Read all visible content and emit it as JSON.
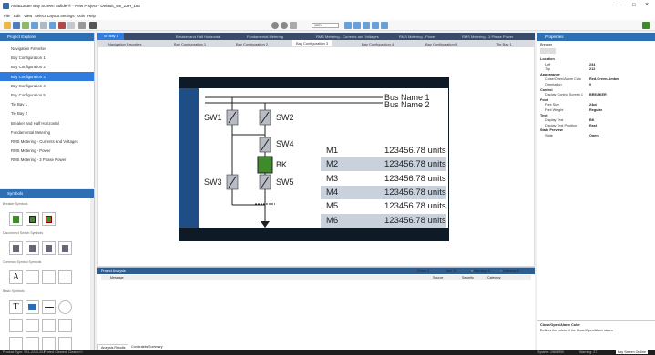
{
  "titlebar": {
    "title": "ActiBLaster Bay Screen Builder® - New Project - Default_ste_22H_183",
    "min": "–",
    "max": "□",
    "close": "×"
  },
  "menu": [
    "File",
    "Edit",
    "View",
    "Select",
    "Layout",
    "Settings",
    "Tools",
    "Help"
  ],
  "toolbar": {
    "zoom": "100%"
  },
  "project_explorer": {
    "title": "Project Explorer",
    "items": [
      "Navigation Favorites",
      "Bay Configuration 1",
      "Bay Configuration 2",
      "Bay Configuration 3",
      "Bay Configuration 4",
      "Bay Configuration 5",
      "Tie Bay 1",
      "Tie Bay 2",
      "Breaker and Half Horizontal",
      "Fundamental Metering",
      "RMS Metering - Currents and Voltages",
      "RMS Metering - Power",
      "RMS Metering - 3 Phase Power"
    ],
    "selected_index": 3
  },
  "symbols": {
    "title": "Symbols",
    "groups": [
      "Breaker Symbols",
      "Disconnect Switch Symbols",
      "Common Symbol Symbols",
      "Basic Symbols"
    ]
  },
  "doc_tabs": [
    "Tie Bay 1",
    "Breaker and Half Horizontal",
    "Fundamental Metering",
    "RMS Metering - Currents and Voltages",
    "RMS Metering - Power",
    "RMS Metering - 3 Phase Power"
  ],
  "doc_subtabs": [
    "Navigation Favorites",
    "Bay Configuration 1",
    "Bay Configuration 2",
    "Bay Configuration 3",
    "Bay Configuration 4",
    "Bay Configuration 5",
    "Tie Bay 1"
  ],
  "diagram": {
    "bus1": "Bus Name 1",
    "bus2": "Bus Name 2",
    "switches": [
      "SW1",
      "SW2",
      "SW4",
      "BK",
      "SW3",
      "SW5"
    ],
    "meters": [
      {
        "name": "M1",
        "value": "123456.78 units"
      },
      {
        "name": "M2",
        "value": "123456.78 units"
      },
      {
        "name": "M3",
        "value": "123456.78 units"
      },
      {
        "name": "M4",
        "value": "123456.78 units"
      },
      {
        "name": "M5",
        "value": "123456.78 units"
      },
      {
        "name": "M6",
        "value": "123456.78 units"
      }
    ],
    "colors": {
      "screen": "#0e1a26",
      "accent_blue": "#1f4e86",
      "breaker_green": "#3f8a2b",
      "meter_shade": "#c8d1dc"
    }
  },
  "output": {
    "title": "Project Analysis",
    "errors": "Errors 2",
    "info": "Info 18",
    "warnings": "Warnings 0",
    "unknown": "Unknown 0",
    "cols": [
      "Message",
      "Source",
      "Severity",
      "Category"
    ],
    "bottom_tabs": [
      "Analysis Results",
      "Constraints Summary"
    ]
  },
  "properties": {
    "title": "Properties",
    "object": "Breaker",
    "rows": [
      {
        "cat": "Location"
      },
      {
        "label": "Left",
        "value": "234"
      },
      {
        "label": "Top",
        "value": "212"
      },
      {
        "cat": "Appearance"
      },
      {
        "label": "Close/Open/Alarm Colo",
        "value": "Red-Green-Amber"
      },
      {
        "label": "Orientation",
        "value": "0"
      },
      {
        "cat": "Control"
      },
      {
        "label": "Display Control Screen 1",
        "value": "BREAKER"
      },
      {
        "cat": "Font"
      },
      {
        "label": "Font Size",
        "value": "24pt"
      },
      {
        "label": "Font Weight",
        "value": "Regular"
      },
      {
        "cat": "Text"
      },
      {
        "label": "Display Text",
        "value": "BK"
      },
      {
        "label": "Display Text Position",
        "value": "East"
      },
      {
        "cat": "State Preview"
      },
      {
        "label": "State",
        "value": "Open"
      }
    ],
    "desc_title": "Close/Open/Alarm Color",
    "desc_text": "Defines the colors of the Close/Open/Alarm states"
  },
  "status": {
    "left": "Product Type: SEL-2240-201",
    "mid": "Protect Cleared: Cleared 0",
    "r1": "System: 1965 990",
    "r2": "Warning: 27",
    "r3": "Bay Screen Outline"
  }
}
